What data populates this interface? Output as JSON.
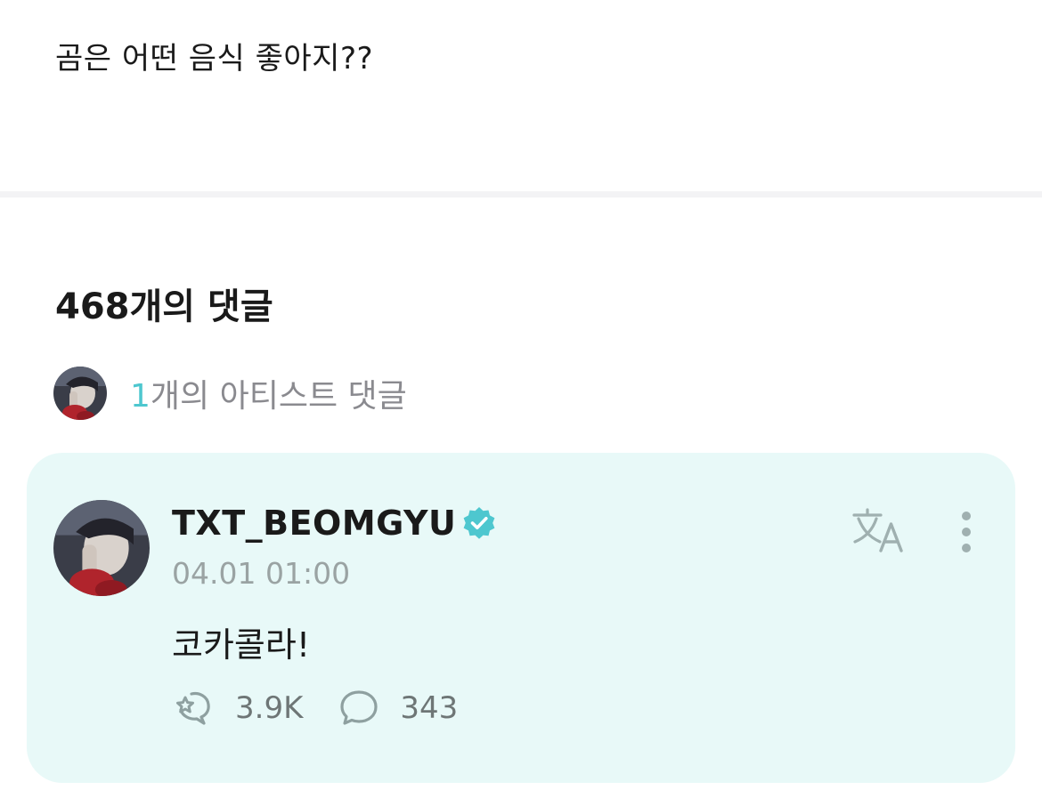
{
  "post": {
    "text": "곰은 어떤 음식 좋아지??"
  },
  "comments_header": {
    "count_label": "468개의 댓글"
  },
  "artist_comments": {
    "count": "1",
    "label": "개의 아티스트 댓글"
  },
  "comment": {
    "username": "TXT_BEOMGYU",
    "verified_icon": "verified-badge-icon",
    "timestamp": "04.01 01:00",
    "body": "코카콜라!",
    "likes": "3.9K",
    "replies": "343",
    "translate_icon": "translate-icon",
    "more_icon": "more-vertical-icon"
  },
  "colors": {
    "accent": "#4ec7cf",
    "card_background": "#e8f9f8",
    "muted_text": "#8a8a8f",
    "icon_gray": "#8ea0a0"
  }
}
